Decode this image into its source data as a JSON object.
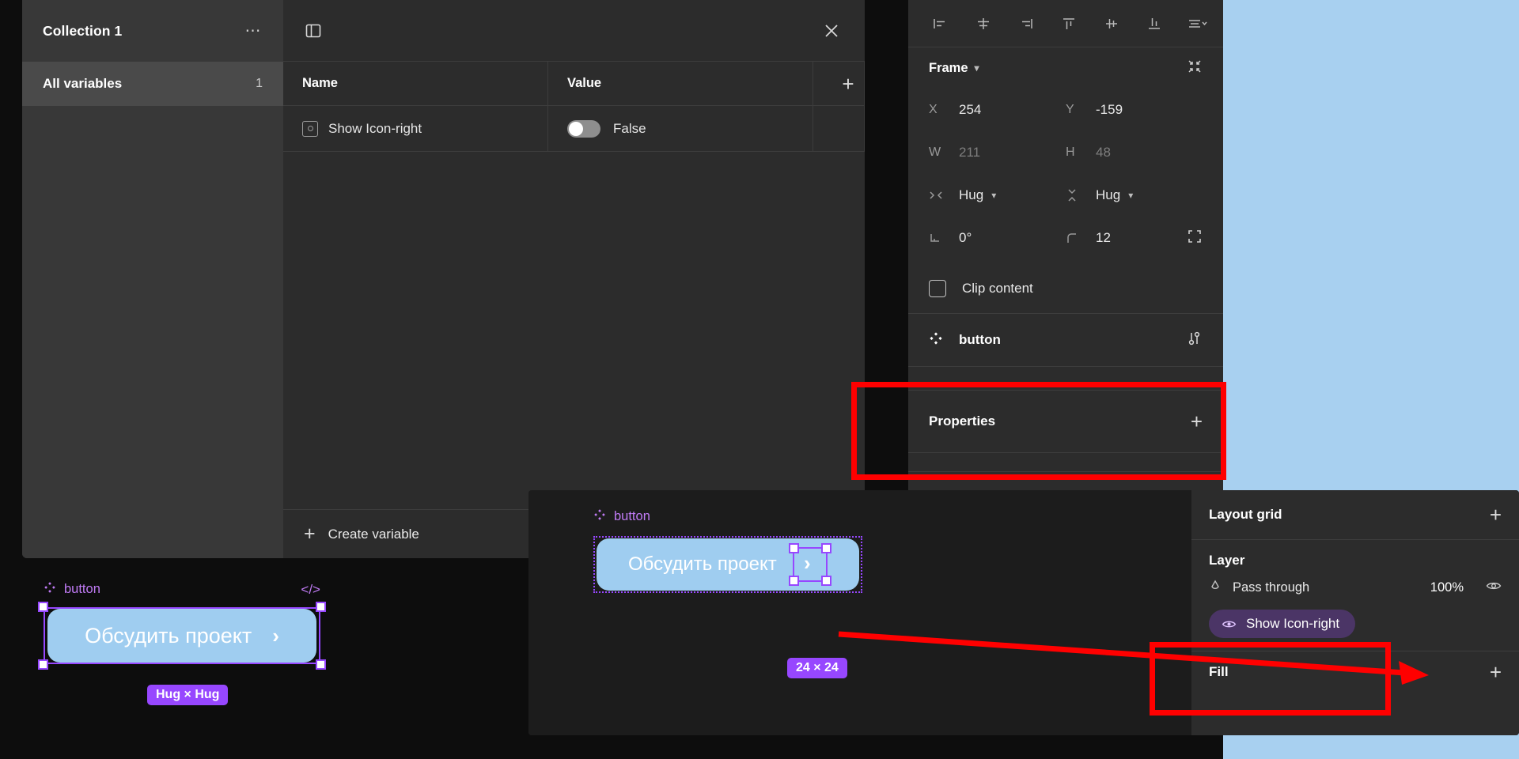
{
  "variables_modal": {
    "sidebar": {
      "collection_title": "Collection 1",
      "more_icon": "ellipsis-icon",
      "all_variables_label": "All variables",
      "all_variables_count": "1"
    },
    "toolbar": {
      "panel_toggle_icon": "sidebar-toggle-icon",
      "close_icon": "close-icon"
    },
    "table": {
      "columns": [
        "Name",
        "Value"
      ],
      "add_column_icon": "plus-icon",
      "rows": [
        {
          "type_icon": "boolean-variable-icon",
          "name": "Show Icon-right",
          "toggle_state": false,
          "value": "False"
        }
      ]
    },
    "footer": {
      "create_icon": "plus-icon",
      "create_label": "Create variable"
    }
  },
  "right_panel": {
    "align_icons": [
      "align-left-icon",
      "align-horizontal-center-icon",
      "align-right-icon",
      "align-top-icon",
      "align-vertical-center-icon",
      "align-bottom-icon",
      "distribute-menu-icon"
    ],
    "frame": {
      "title": "Frame",
      "chevron_icon": "chevron-down-icon",
      "collapse_icon": "collapse-corners-icon",
      "fields": [
        {
          "label": "X",
          "value": "254",
          "dim": false
        },
        {
          "label": "Y",
          "value": "-159",
          "dim": false
        },
        {
          "label": "W",
          "value": "211",
          "dim": true
        },
        {
          "label": "H",
          "value": "48",
          "dim": true
        }
      ],
      "resizing": [
        {
          "icon": "horizontal-resize-icon",
          "value": "Hug"
        },
        {
          "icon": "vertical-resize-icon",
          "value": "Hug"
        }
      ],
      "rotation": {
        "icon": "rotation-icon",
        "value": "0°"
      },
      "corner_radius": {
        "icon": "corner-radius-icon",
        "value": "12"
      },
      "independent_corners_icon": "independent-corners-icon",
      "clip_content_label": "Clip content",
      "clip_content_checked": false
    },
    "component": {
      "icon": "component-icon",
      "name": "button",
      "settings_icon": "sliders-icon"
    },
    "properties": {
      "title": "Properties",
      "add_icon": "plus-icon"
    }
  },
  "preview_left": {
    "component_icon": "component-icon",
    "component_name": "button",
    "code_icon": "code-icon",
    "button_label": "Обсудить проект",
    "chevron_icon": "chevron-right-icon",
    "size_badge": "Hug × Hug"
  },
  "inset": {
    "component_icon": "component-icon",
    "component_name": "button",
    "button_label": "Обсудить проект",
    "chevron_icon": "chevron-right-icon",
    "size_badge": "24 × 24",
    "panel": {
      "layout_grid_title": "Layout grid",
      "layout_grid_add_icon": "plus-icon",
      "layer_title": "Layer",
      "blend_icon": "blend-mode-icon",
      "blend_mode": "Pass through",
      "opacity": "100%",
      "visibility_icon": "eye-icon",
      "applied_variable_icon": "eye-icon",
      "applied_variable_label": "Show Icon-right",
      "fill_title": "Fill",
      "fill_add_icon": "plus-icon"
    }
  },
  "annotations": {
    "red_rect_properties": "properties-section-highlight",
    "red_rect_show_icon": "show-icon-right-highlight",
    "red_arrow": "arrow-pointing-to-variable"
  },
  "colors": {
    "accent_purple": "#9747FF",
    "button_blue": "#9FCDF0",
    "canvas_blue": "#A8D0F0",
    "annotation_red": "#FF0000",
    "panel_bg": "#2c2c2c"
  }
}
